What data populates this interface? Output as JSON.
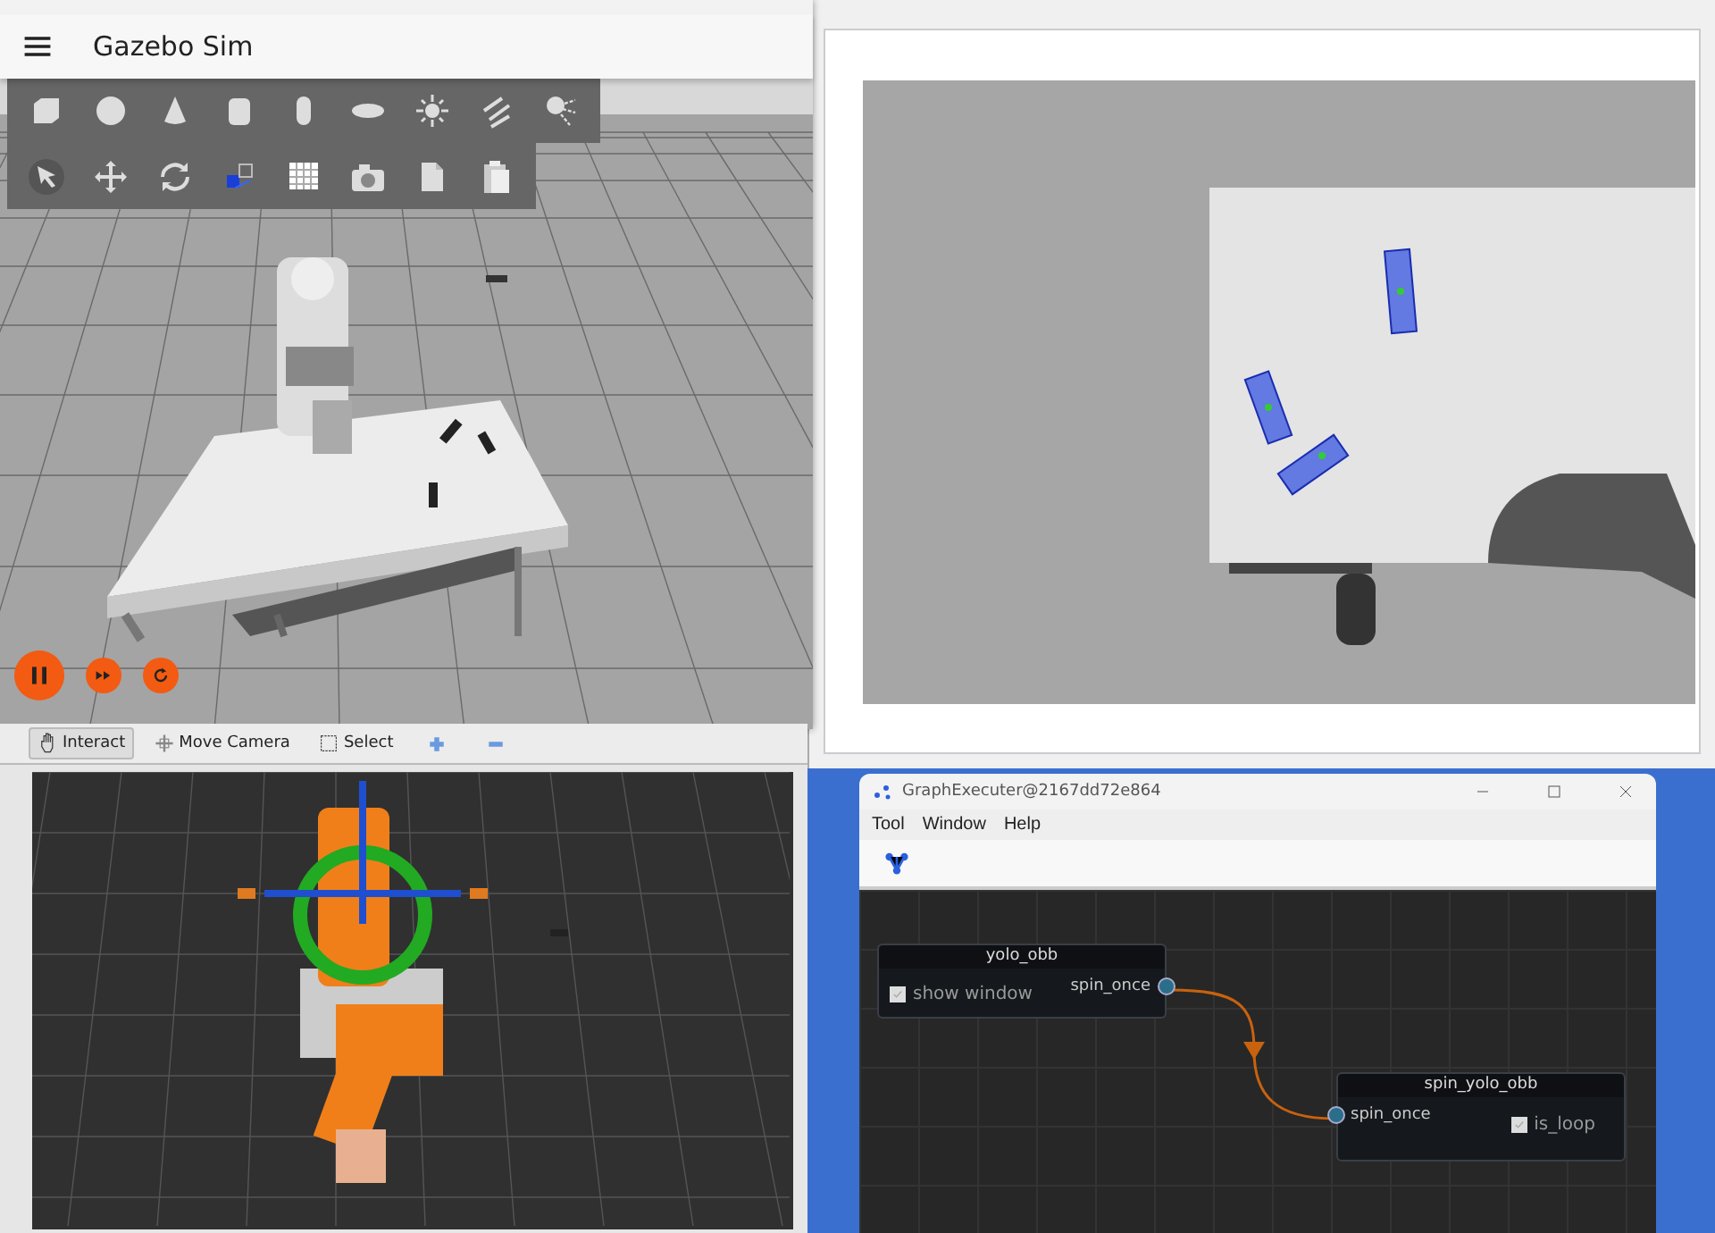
{
  "gazebo": {
    "title": "Gazebo Sim",
    "sim_running": true
  },
  "rviz": {
    "tools": [
      {
        "label": "Interact",
        "selected": true
      },
      {
        "label": "Move Camera",
        "selected": false
      },
      {
        "label": "Select",
        "selected": false
      }
    ]
  },
  "graph_executer": {
    "title": "GraphExecuter@2167dd72e864",
    "menu": [
      "Tool",
      "Window",
      "Help"
    ],
    "nodes": [
      {
        "title": "yolo_obb",
        "output_port": "spin_once",
        "option": {
          "label": "show window",
          "checked": true
        }
      },
      {
        "title": "spin_yolo_obb",
        "input_port": "spin_once",
        "option": {
          "label": "is_loop",
          "checked": true
        }
      }
    ]
  }
}
